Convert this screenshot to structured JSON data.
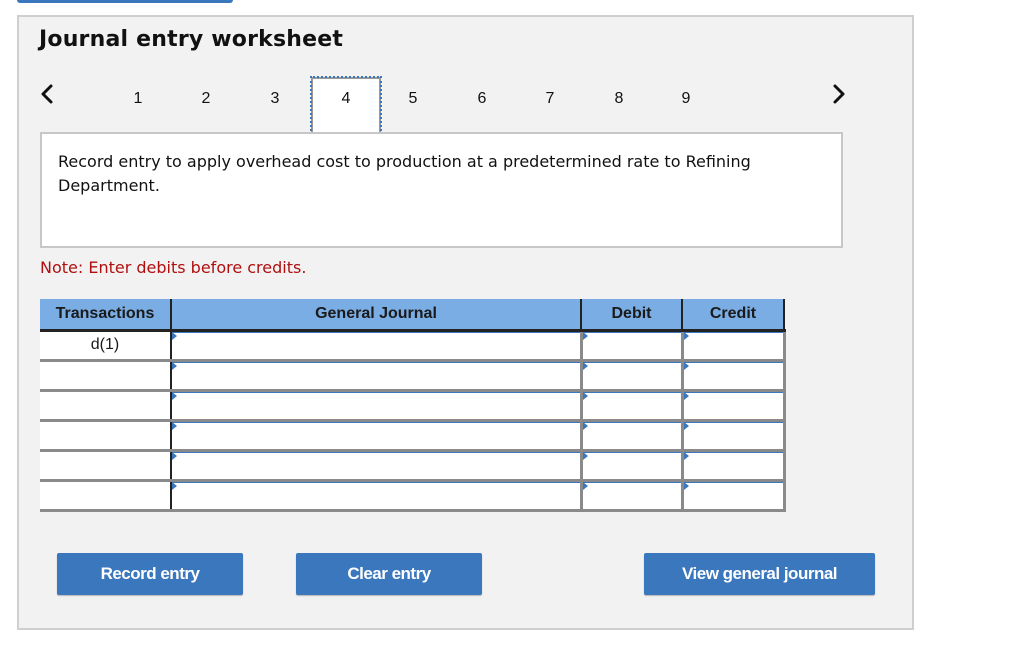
{
  "worksheet": {
    "title": "Journal entry worksheet",
    "pager": {
      "prev_icon": "chevron-left-icon",
      "next_icon": "chevron-right-icon",
      "tabs": [
        "1",
        "2",
        "3",
        "4",
        "5",
        "6",
        "7",
        "8",
        "9"
      ],
      "active_tab": "4"
    },
    "description": "Record entry to apply overhead cost to production at a predetermined rate to Refining Department.",
    "note": "Note: Enter debits before credits.",
    "table": {
      "headers": {
        "transactions": "Transactions",
        "general_journal": "General Journal",
        "debit": "Debit",
        "credit": "Credit"
      },
      "rows": [
        {
          "transaction": "d(1)",
          "account": "",
          "debit": "",
          "credit": ""
        },
        {
          "transaction": "",
          "account": "",
          "debit": "",
          "credit": ""
        },
        {
          "transaction": "",
          "account": "",
          "debit": "",
          "credit": ""
        },
        {
          "transaction": "",
          "account": "",
          "debit": "",
          "credit": ""
        },
        {
          "transaction": "",
          "account": "",
          "debit": "",
          "credit": ""
        },
        {
          "transaction": "",
          "account": "",
          "debit": "",
          "credit": ""
        }
      ]
    },
    "buttons": {
      "record": "Record entry",
      "clear": "Clear entry",
      "view": "View general journal"
    },
    "colors": {
      "accent": "#3a77bd",
      "header_bg": "#7aade4",
      "note": "#b00f0f",
      "panel_bg": "#f2f2f2"
    }
  }
}
